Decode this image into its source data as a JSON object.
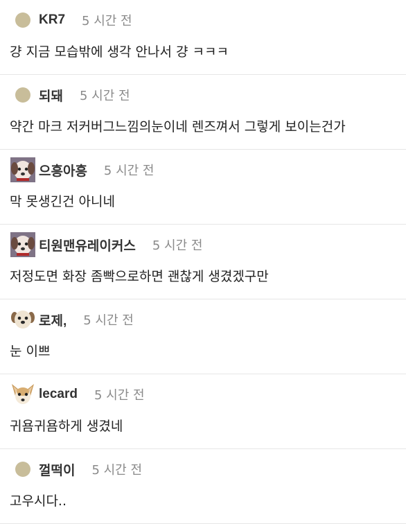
{
  "comments": [
    {
      "author": "KR7",
      "time": "5 시간 전",
      "text": "걍 지금 모습밖에 생각 안나서 걍 ㅋㅋㅋ",
      "avatar_icon": "default-avatar"
    },
    {
      "author": "되돼",
      "time": "5 시간 전",
      "text": "약간 마크 저커버그느낌의눈이네 렌즈껴서 그렇게 보이는건가",
      "avatar_icon": "default-avatar"
    },
    {
      "author": "으흥아흥",
      "time": "5 시간 전",
      "text": "막 못생긴건 아니네",
      "avatar_icon": "dog-avatar"
    },
    {
      "author": "티원맨유레이커스",
      "time": "5 시간 전",
      "text": "저정도면 화장 좀빡으로하면 괜찮게 생겼겠구만",
      "avatar_icon": "dog-avatar"
    },
    {
      "author": "로제,",
      "time": "5 시간 전",
      "text": "눈 이쁘",
      "avatar_icon": "puppy-avatar"
    },
    {
      "author": "lecard",
      "time": "5 시간 전",
      "text": "귀욤귀욤하게 생겼네",
      "avatar_icon": "chihuahua-avatar"
    },
    {
      "author": "껄떡이",
      "time": "5 시간 전",
      "text": "고우시다..",
      "avatar_icon": "default-avatar"
    }
  ]
}
